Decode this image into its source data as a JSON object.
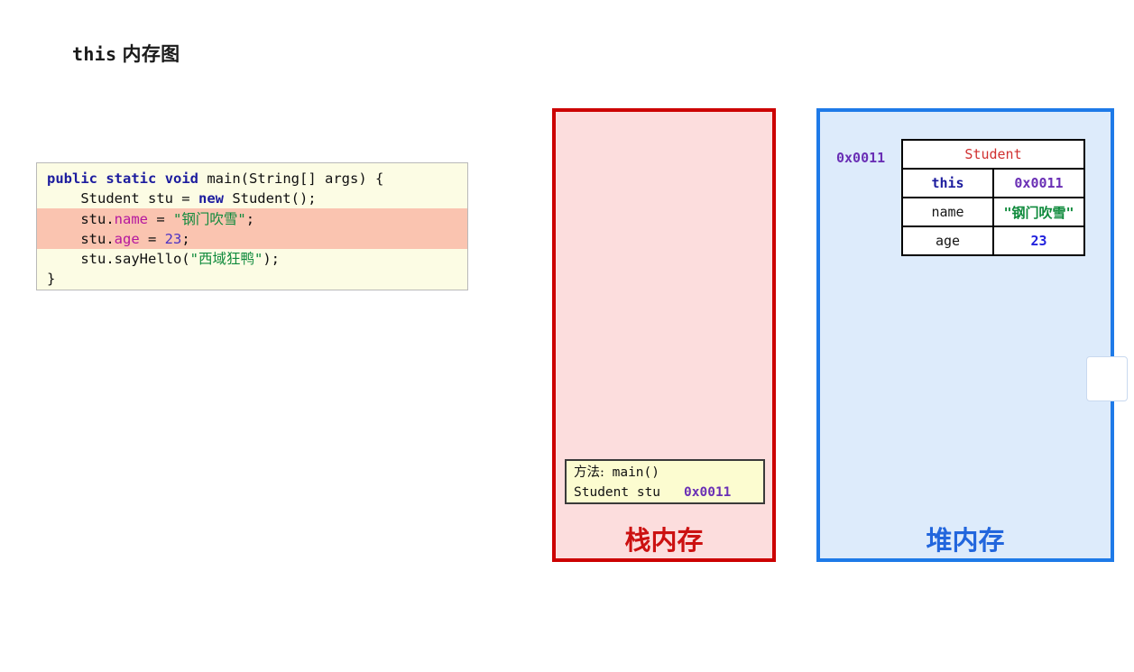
{
  "title": {
    "keyword": "this",
    "text": "内存图"
  },
  "code_block": {
    "background_color": "#fcfce4",
    "highlight_color": "#fac4b0",
    "highlighted_line_indices": [
      2,
      3
    ],
    "lines": [
      {
        "index": 0,
        "text": "public static void main(String[] args) {",
        "tokens": [
          {
            "t": "public",
            "c": "kw"
          },
          {
            "t": " ",
            "c": "plain"
          },
          {
            "t": "static",
            "c": "kw"
          },
          {
            "t": " ",
            "c": "plain"
          },
          {
            "t": "void",
            "c": "kw"
          },
          {
            "t": " main(String[] args) {",
            "c": "plain"
          }
        ]
      },
      {
        "index": 1,
        "text": "    Student stu = new Student();",
        "tokens": [
          {
            "t": "    Student stu = ",
            "c": "plain"
          },
          {
            "t": "new",
            "c": "kw2"
          },
          {
            "t": " Student();",
            "c": "plain"
          }
        ]
      },
      {
        "index": 2,
        "text": "    stu.name = \"钢门吹雪\";",
        "tokens": [
          {
            "t": "    stu.",
            "c": "plain"
          },
          {
            "t": "name",
            "c": "field"
          },
          {
            "t": " = ",
            "c": "plain"
          },
          {
            "t": "\"",
            "c": "str"
          },
          {
            "t": "钢门吹雪",
            "c": "strcjk"
          },
          {
            "t": "\"",
            "c": "str"
          },
          {
            "t": ";",
            "c": "plain"
          }
        ]
      },
      {
        "index": 3,
        "text": "    stu.age = 23;",
        "tokens": [
          {
            "t": "    stu.",
            "c": "plain"
          },
          {
            "t": "age",
            "c": "field"
          },
          {
            "t": " = ",
            "c": "plain"
          },
          {
            "t": "23",
            "c": "num"
          },
          {
            "t": ";",
            "c": "plain"
          }
        ]
      },
      {
        "index": 4,
        "text": "    stu.sayHello(\"西域狂鸭\");",
        "tokens": [
          {
            "t": "    stu.sayHello(",
            "c": "plain"
          },
          {
            "t": "\"",
            "c": "str"
          },
          {
            "t": "西域狂鸭",
            "c": "strcjk"
          },
          {
            "t": "\"",
            "c": "str"
          },
          {
            "t": ");",
            "c": "plain"
          }
        ]
      },
      {
        "index": 5,
        "text": "}",
        "tokens": [
          {
            "t": "}",
            "c": "plain"
          }
        ]
      }
    ]
  },
  "stack": {
    "label": "栈内存",
    "border_color": "#cc0000",
    "fill_color": "#fcdddd",
    "label_color": "#cc1111",
    "frame": {
      "method_label": "方法:",
      "method_name": " main()",
      "variable": "Student stu",
      "address": "0x0011",
      "address_color": "#6a2fb5"
    }
  },
  "heap": {
    "label": "堆内存",
    "border_color": "#1e7ae8",
    "fill_color": "#ddebfb",
    "label_color": "#2266dd",
    "address_label": "0x0011",
    "address_label_color": "#6a2fb5",
    "object": {
      "class_name": "Student",
      "class_name_color": "#d03030",
      "rows": [
        {
          "key": "this",
          "value": "0x0011"
        },
        {
          "key": "name",
          "value": "\"钢门吹雪\""
        },
        {
          "key": "age",
          "value": "23"
        }
      ]
    }
  }
}
